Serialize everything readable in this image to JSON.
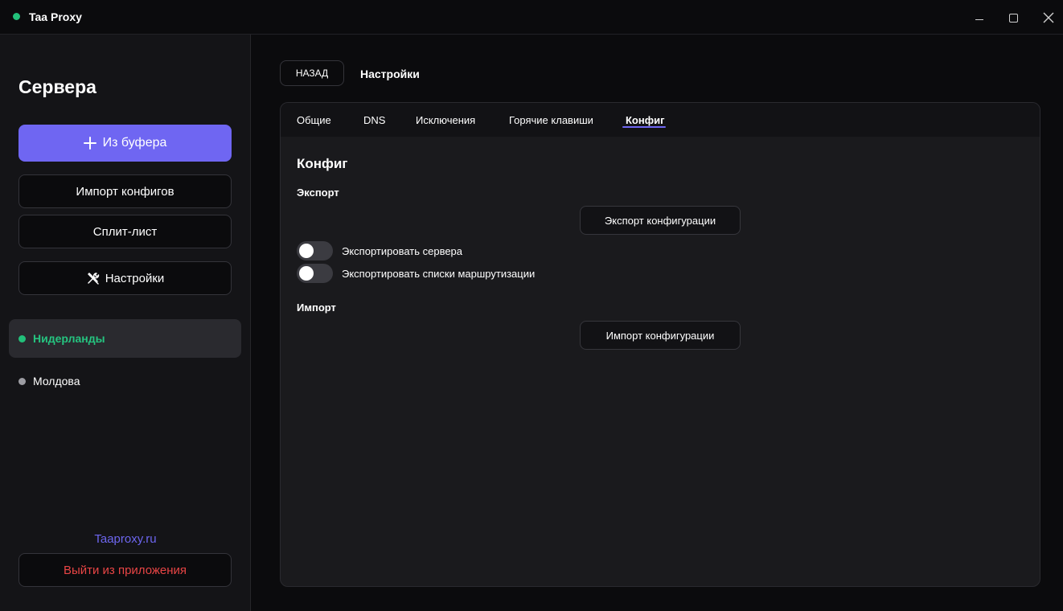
{
  "window": {
    "title": "Taa Proxy",
    "status_color": "#22c07a"
  },
  "sidebar": {
    "title": "Сервера",
    "buttons": {
      "clipboard": "Из буфера",
      "import_configs": "Импорт конфигов",
      "split_list": "Сплит-лист",
      "settings": "Настройки"
    },
    "servers": [
      {
        "name": "Нидерланды",
        "status": "active",
        "color": "#22c07a"
      },
      {
        "name": "Молдова",
        "status": "inactive",
        "color": "#9d9da3"
      }
    ],
    "site_link": "Taaproxy.ru",
    "logout": "Выйти из приложения"
  },
  "header": {
    "back": "НАЗАД",
    "title": "Настройки"
  },
  "tabs": [
    {
      "label": "Общие",
      "active": false
    },
    {
      "label": "DNS",
      "active": false
    },
    {
      "label": "Исключения",
      "active": false
    },
    {
      "label": "Горячие клавиши",
      "active": false
    },
    {
      "label": "Конфиг",
      "active": true
    }
  ],
  "config": {
    "title": "Конфиг",
    "export": {
      "heading": "Экспорт",
      "button": "Экспорт конфигурации",
      "toggles": [
        {
          "label": "Экспортировать сервера",
          "on": false
        },
        {
          "label": "Экспортировать списки маршрутизации",
          "on": false
        }
      ]
    },
    "import": {
      "heading": "Импорт",
      "button": "Импорт конфигурации"
    }
  },
  "colors": {
    "accent": "#6f66f2",
    "active_server": "#25c480",
    "danger": "#e84545"
  },
  "icons": [
    "app-status-icon",
    "minimize-icon",
    "maximize-icon",
    "close-icon",
    "plus-icon",
    "tools-icon",
    "server-status-icon"
  ]
}
